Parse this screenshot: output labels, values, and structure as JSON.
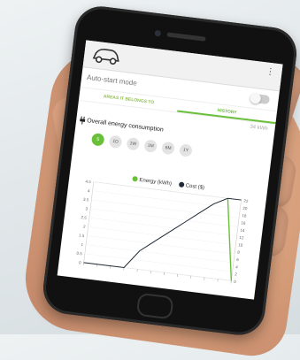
{
  "appbar": {
    "icon": "car-icon",
    "menu_icon": "overflow-menu-icon"
  },
  "autostart": {
    "label": "Auto-start mode",
    "enabled": false
  },
  "tabs": [
    {
      "label": "AREAS IT BELONGS TO",
      "active": false
    },
    {
      "label": "HISTORY",
      "active": true
    }
  ],
  "summary": {
    "value": "34 kWh"
  },
  "section": {
    "title": "Overall energy consumption",
    "icon": "plug-icon"
  },
  "ranges": [
    {
      "label": "S",
      "active": true
    },
    {
      "label": "1D",
      "active": false
    },
    {
      "label": "1W",
      "active": false
    },
    {
      "label": "1M",
      "active": false
    },
    {
      "label": "6M",
      "active": false
    },
    {
      "label": "1Y",
      "active": false
    }
  ],
  "legend": [
    {
      "label": "Energy (kWh)",
      "color": "#6abf3a"
    },
    {
      "label": "Cost ($)",
      "color": "#1f2a36"
    }
  ],
  "chart_data": {
    "type": "line",
    "y_left_ticks": [
      "4.5",
      "4",
      "3.5",
      "3",
      "2.5",
      "2",
      "1.5",
      "1",
      "0.5",
      "0"
    ],
    "y_right_ticks": [
      "22",
      "20",
      "18",
      "16",
      "14",
      "12",
      "10",
      "8",
      "6",
      "4",
      "2",
      "0"
    ],
    "ylim_left": [
      0,
      4.5
    ],
    "ylim_right": [
      0,
      22
    ],
    "x_count": 12,
    "series": [
      {
        "name": "Energy (kWh)",
        "color": "#6abf3a",
        "axis": "left",
        "values": [
          null,
          null,
          null,
          null,
          null,
          null,
          null,
          null,
          null,
          null,
          4.5,
          0
        ]
      },
      {
        "name": "Cost ($)",
        "color": "#1f2a36",
        "axis": "right",
        "values": [
          0,
          0,
          0,
          0,
          5,
          8,
          11,
          14,
          17,
          20,
          22,
          22
        ]
      }
    ]
  }
}
